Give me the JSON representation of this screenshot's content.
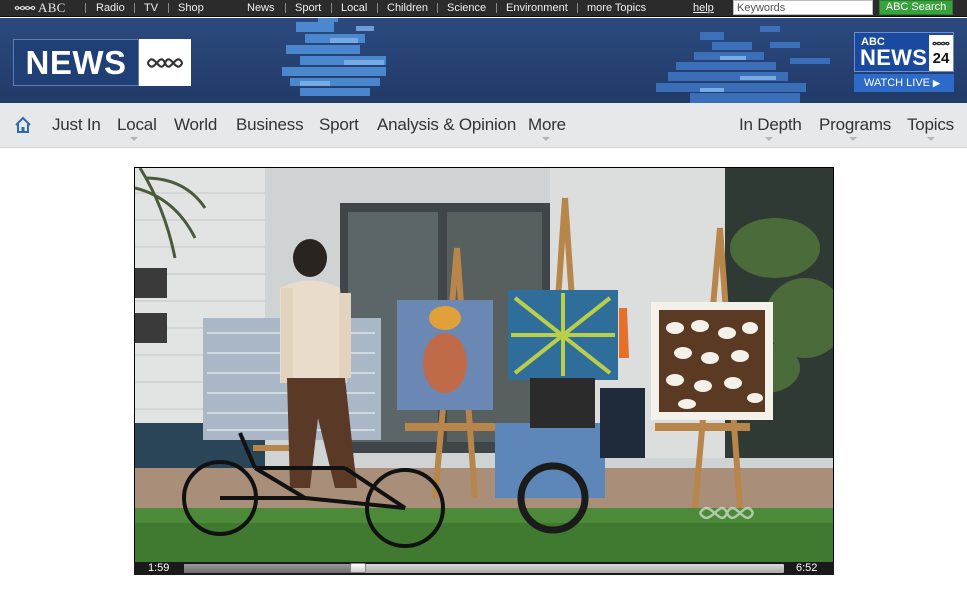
{
  "topbar": {
    "abc_label": "ABC",
    "links": [
      "Radio",
      "TV",
      "Shop"
    ],
    "sections": [
      "News",
      "Sport",
      "Local",
      "Children",
      "Science",
      "Environment",
      "more Topics"
    ],
    "help": "help",
    "search_placeholder": "Keywords",
    "search_button": "ABC Search"
  },
  "masthead": {
    "news_label": "NEWS",
    "news24": {
      "abc": "ABC",
      "news": "NEWS",
      "num": "24",
      "watch_live": "WATCH LIVE"
    }
  },
  "nav": {
    "left": [
      "Just In",
      "Local",
      "World",
      "Business",
      "Sport",
      "Analysis & Opinion",
      "More"
    ],
    "right": [
      "In Depth",
      "Programs",
      "Topics"
    ]
  },
  "video": {
    "current_time": "1:59",
    "duration": "6:52",
    "progress": 0.29
  },
  "colors": {
    "topbar_bg": "#2b2b2b",
    "masthead_blue": "#213a68",
    "search_green": "#3aa13f",
    "nav_bg": "#e7e8ea"
  }
}
